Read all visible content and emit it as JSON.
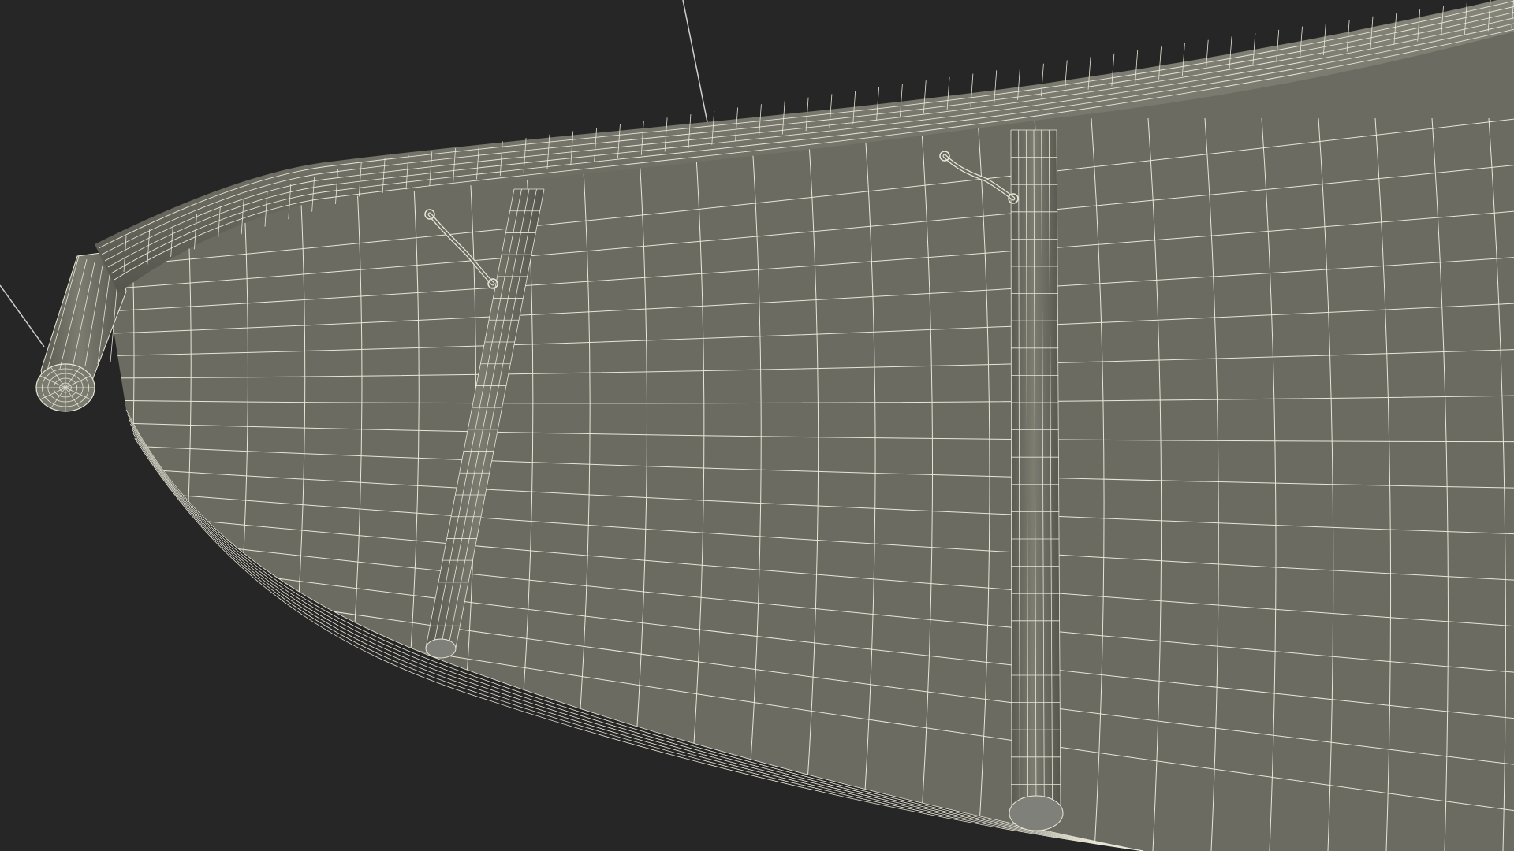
{
  "scene": {
    "subject": "wireframe-render",
    "colors": {
      "background": "#262626",
      "surface": "#6b6b62",
      "surface_dark": "#5f5f57",
      "tube": "#757569",
      "tube_shade": "#5c5c53",
      "wire": "#e8e6d6",
      "guide_line": "#cfcfcf"
    }
  }
}
